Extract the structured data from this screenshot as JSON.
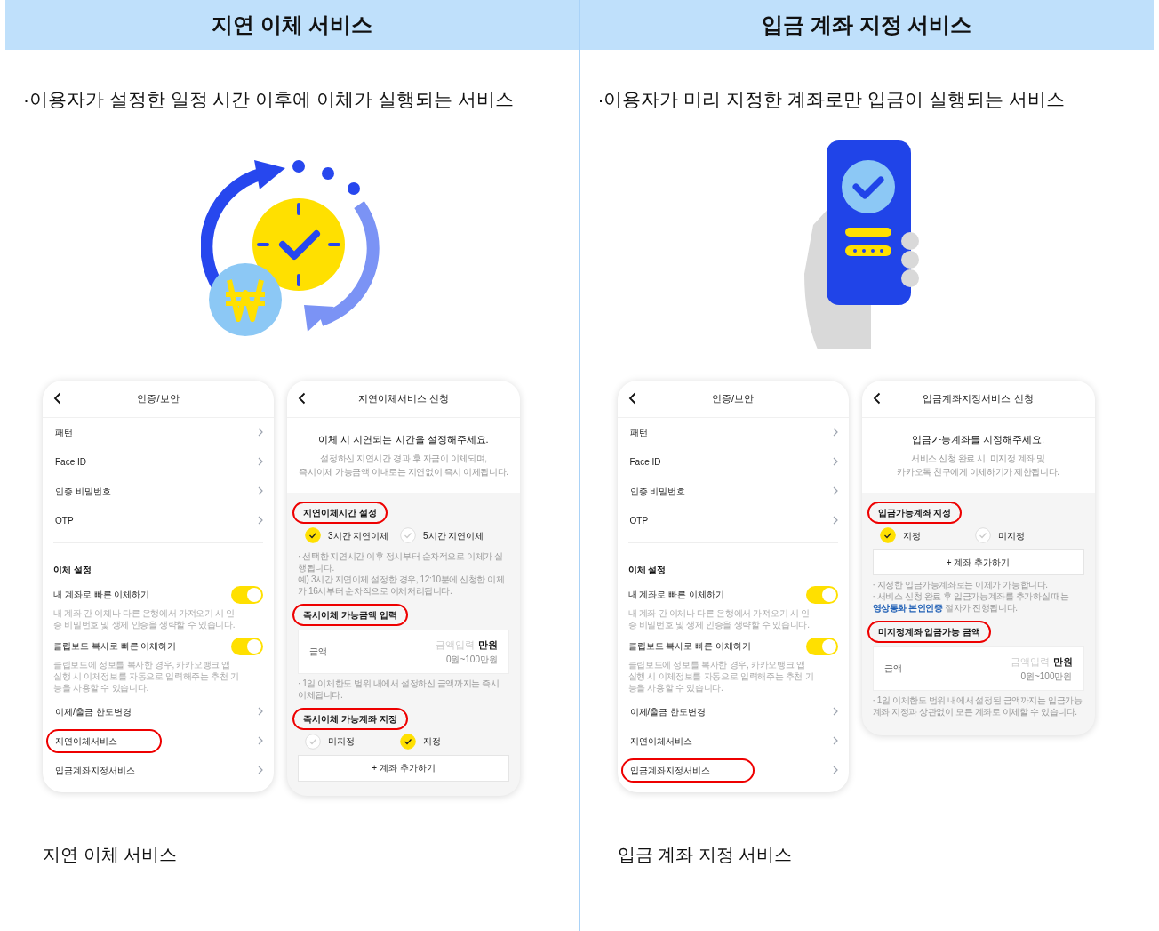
{
  "columns": [
    {
      "title": "지연 이체 서비스",
      "description": "·이용자가 설정한 일정 시간 이후에 이체가 실행되는 서비스",
      "illustration": {
        "kind": "clock"
      },
      "settings_screen": {
        "title": "인증/보안",
        "items": [
          {
            "kind": "link",
            "label": "패턴",
            "highlighted": false
          },
          {
            "kind": "link",
            "label": "Face ID",
            "highlighted": false
          },
          {
            "kind": "link",
            "label": "인증 비밀번호",
            "highlighted": false
          },
          {
            "kind": "link",
            "label": "OTP",
            "highlighted": false
          },
          {
            "kind": "section",
            "label": "이체 설정"
          },
          {
            "kind": "toggle",
            "label": "내 계좌로 빠른 이체하기",
            "description": "내 계좌 간 이체나 다른 은행에서 가져오기 시 인증 비밀번호 및 생체 인증을 생략할 수 있습니다.",
            "on": true
          },
          {
            "kind": "toggle",
            "label": "클립보드 복사로 빠른 이체하기",
            "description": "클립보드에 정보를 복사한 경우, 카카오뱅크 앱 실행 시 이체정보를 자동으로 입력해주는 추천 기능을 사용할 수 있습니다.",
            "on": true
          },
          {
            "kind": "link",
            "label": "이체/출금 한도변경",
            "highlighted": false
          },
          {
            "kind": "link",
            "label": "지연이체서비스",
            "highlighted": true
          },
          {
            "kind": "link",
            "label": "입금계좌지정서비스",
            "highlighted": false
          }
        ]
      },
      "form_screen": {
        "title": "지연이체서비스 신청",
        "heading": "이체 시 지연되는 시간을 설정해주세요.",
        "subtext_lines": [
          "설정하신 지연시간 경과 후 자금이 이체되며,",
          "즉시이체 가능금액 이내로는 지연없이 즉시 이체됩니다."
        ],
        "groups": [
          {
            "label": "지연이체시간 설정",
            "highlighted": true,
            "content": [
              {
                "kind": "options",
                "options": [
                  {
                    "label": "3시간 지연이체",
                    "selected": true
                  },
                  {
                    "label": "5시간 지연이체",
                    "selected": false
                  }
                ]
              },
              {
                "kind": "notes",
                "lines": [
                  {
                    "text": "· 선택한 지연시간 이후 정시부터 순차적으로 이체가 실행됩니다."
                  },
                  {
                    "text": "예) 3시간 지연이체 설정한 경우, 12:10분에 신청한 이체가 16시부터 순차적으로 이체처리됩니다."
                  }
                ]
              }
            ]
          },
          {
            "label": "즉시이체 가능금액 입력",
            "highlighted": true,
            "content": [
              {
                "kind": "amount",
                "label": "금액",
                "placeholder": "금액입력",
                "unit": "만원",
                "range": "0원~100만원"
              },
              {
                "kind": "notes",
                "lines": [
                  {
                    "text": "· 1일 이체한도 범위 내에서 설정하신 금액까지는 즉시 이체됩니다."
                  }
                ]
              }
            ]
          },
          {
            "label": "즉시이체 가능계좌 지정",
            "highlighted": true,
            "content": [
              {
                "kind": "options",
                "options": [
                  {
                    "label": "미지정",
                    "selected": false
                  },
                  {
                    "label": "지정",
                    "selected": true
                  }
                ]
              },
              {
                "kind": "add",
                "label": "+ 계좌 추가하기"
              }
            ]
          }
        ]
      },
      "caption": "지연 이체 서비스"
    },
    {
      "title": "입금 계좌 지정 서비스",
      "description": "·이용자가 미리 지정한 계좌로만 입금이 실행되는 서비스",
      "illustration": {
        "kind": "phone"
      },
      "settings_screen": {
        "title": "인증/보안",
        "items": [
          {
            "kind": "link",
            "label": "패턴",
            "highlighted": false
          },
          {
            "kind": "link",
            "label": "Face ID",
            "highlighted": false
          },
          {
            "kind": "link",
            "label": "인증 비밀번호",
            "highlighted": false
          },
          {
            "kind": "link",
            "label": "OTP",
            "highlighted": false
          },
          {
            "kind": "section",
            "label": "이체 설정"
          },
          {
            "kind": "toggle",
            "label": "내 계좌로 빠른 이체하기",
            "description": "내 계좌 간 이체나 다른 은행에서 가져오기 시 인증 비밀번호 및 생체 인증을 생략할 수 있습니다.",
            "on": true
          },
          {
            "kind": "toggle",
            "label": "클립보드 복사로 빠른 이체하기",
            "description": "클립보드에 정보를 복사한 경우, 카카오뱅크 앱 실행 시 이체정보를 자동으로 입력해주는 추천 기능을 사용할 수 있습니다.",
            "on": true
          },
          {
            "kind": "link",
            "label": "이체/출금 한도변경",
            "highlighted": false
          },
          {
            "kind": "link",
            "label": "지연이체서비스",
            "highlighted": false
          },
          {
            "kind": "link",
            "label": "입금계좌지정서비스",
            "highlighted": true
          }
        ]
      },
      "form_screen": {
        "title": "입금계좌지정서비스 신청",
        "heading": "입금가능계좌를 지정해주세요.",
        "subtext_lines": [
          "서비스 신청 완료 시, 미지정 계좌 및",
          "카카오톡 친구에게 이체하기가 제한됩니다."
        ],
        "groups": [
          {
            "label": "입금가능계좌 지정",
            "highlighted": true,
            "content": [
              {
                "kind": "options",
                "options": [
                  {
                    "label": "지정",
                    "selected": true
                  },
                  {
                    "label": "미지정",
                    "selected": false
                  }
                ]
              },
              {
                "kind": "add",
                "label": "+ 계좌 추가하기"
              },
              {
                "kind": "notes",
                "lines": [
                  {
                    "text": "· 지정한 입금가능계좌로는 이체가 가능합니다."
                  },
                  {
                    "text": "· 서비스 신청 완료 후 입금가능계좌를 추가하실 때는",
                    "link": "영상통화 본인인증",
                    "after": "절차가 진행됩니다."
                  }
                ]
              }
            ]
          },
          {
            "label": "미지정계좌 입금가능 금액",
            "highlighted": true,
            "content": [
              {
                "kind": "amount",
                "label": "금액",
                "placeholder": "금액입력",
                "unit": "만원",
                "range": "0원~100만원"
              },
              {
                "kind": "notes",
                "lines": [
                  {
                    "text": "· 1일 이체한도 범위 내에서 설정된 금액까지는 입금가능계좌 지정과 상관없이 모든 계좌로 이체할 수 있습니다."
                  }
                ]
              }
            ]
          }
        ]
      },
      "caption": "입금 계좌 지정 서비스"
    }
  ]
}
